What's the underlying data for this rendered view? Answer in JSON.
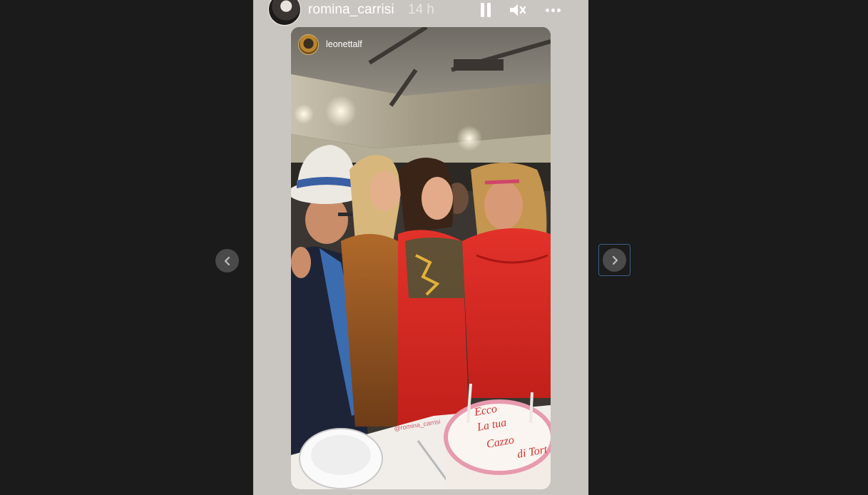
{
  "story": {
    "username": "romina_carrisi",
    "timestamp": "14 h",
    "icons": {
      "pause": "pause-icon",
      "mute": "volume-muted-icon",
      "more": "more-horizontal-icon",
      "prev": "chevron-left-icon",
      "next": "chevron-right-icon"
    },
    "reshared_post": {
      "author": "leonettalf",
      "photo_mention": "@romina_carrisi",
      "cake_text": [
        "Ecco",
        "La tua",
        "Cazzo",
        "di Tort"
      ]
    }
  },
  "colors": {
    "backdrop": "#1b1b1b",
    "story_background": "#c9c6c1",
    "nav_button": "#4a4a4a",
    "focus_outline": "#3d5f86"
  }
}
